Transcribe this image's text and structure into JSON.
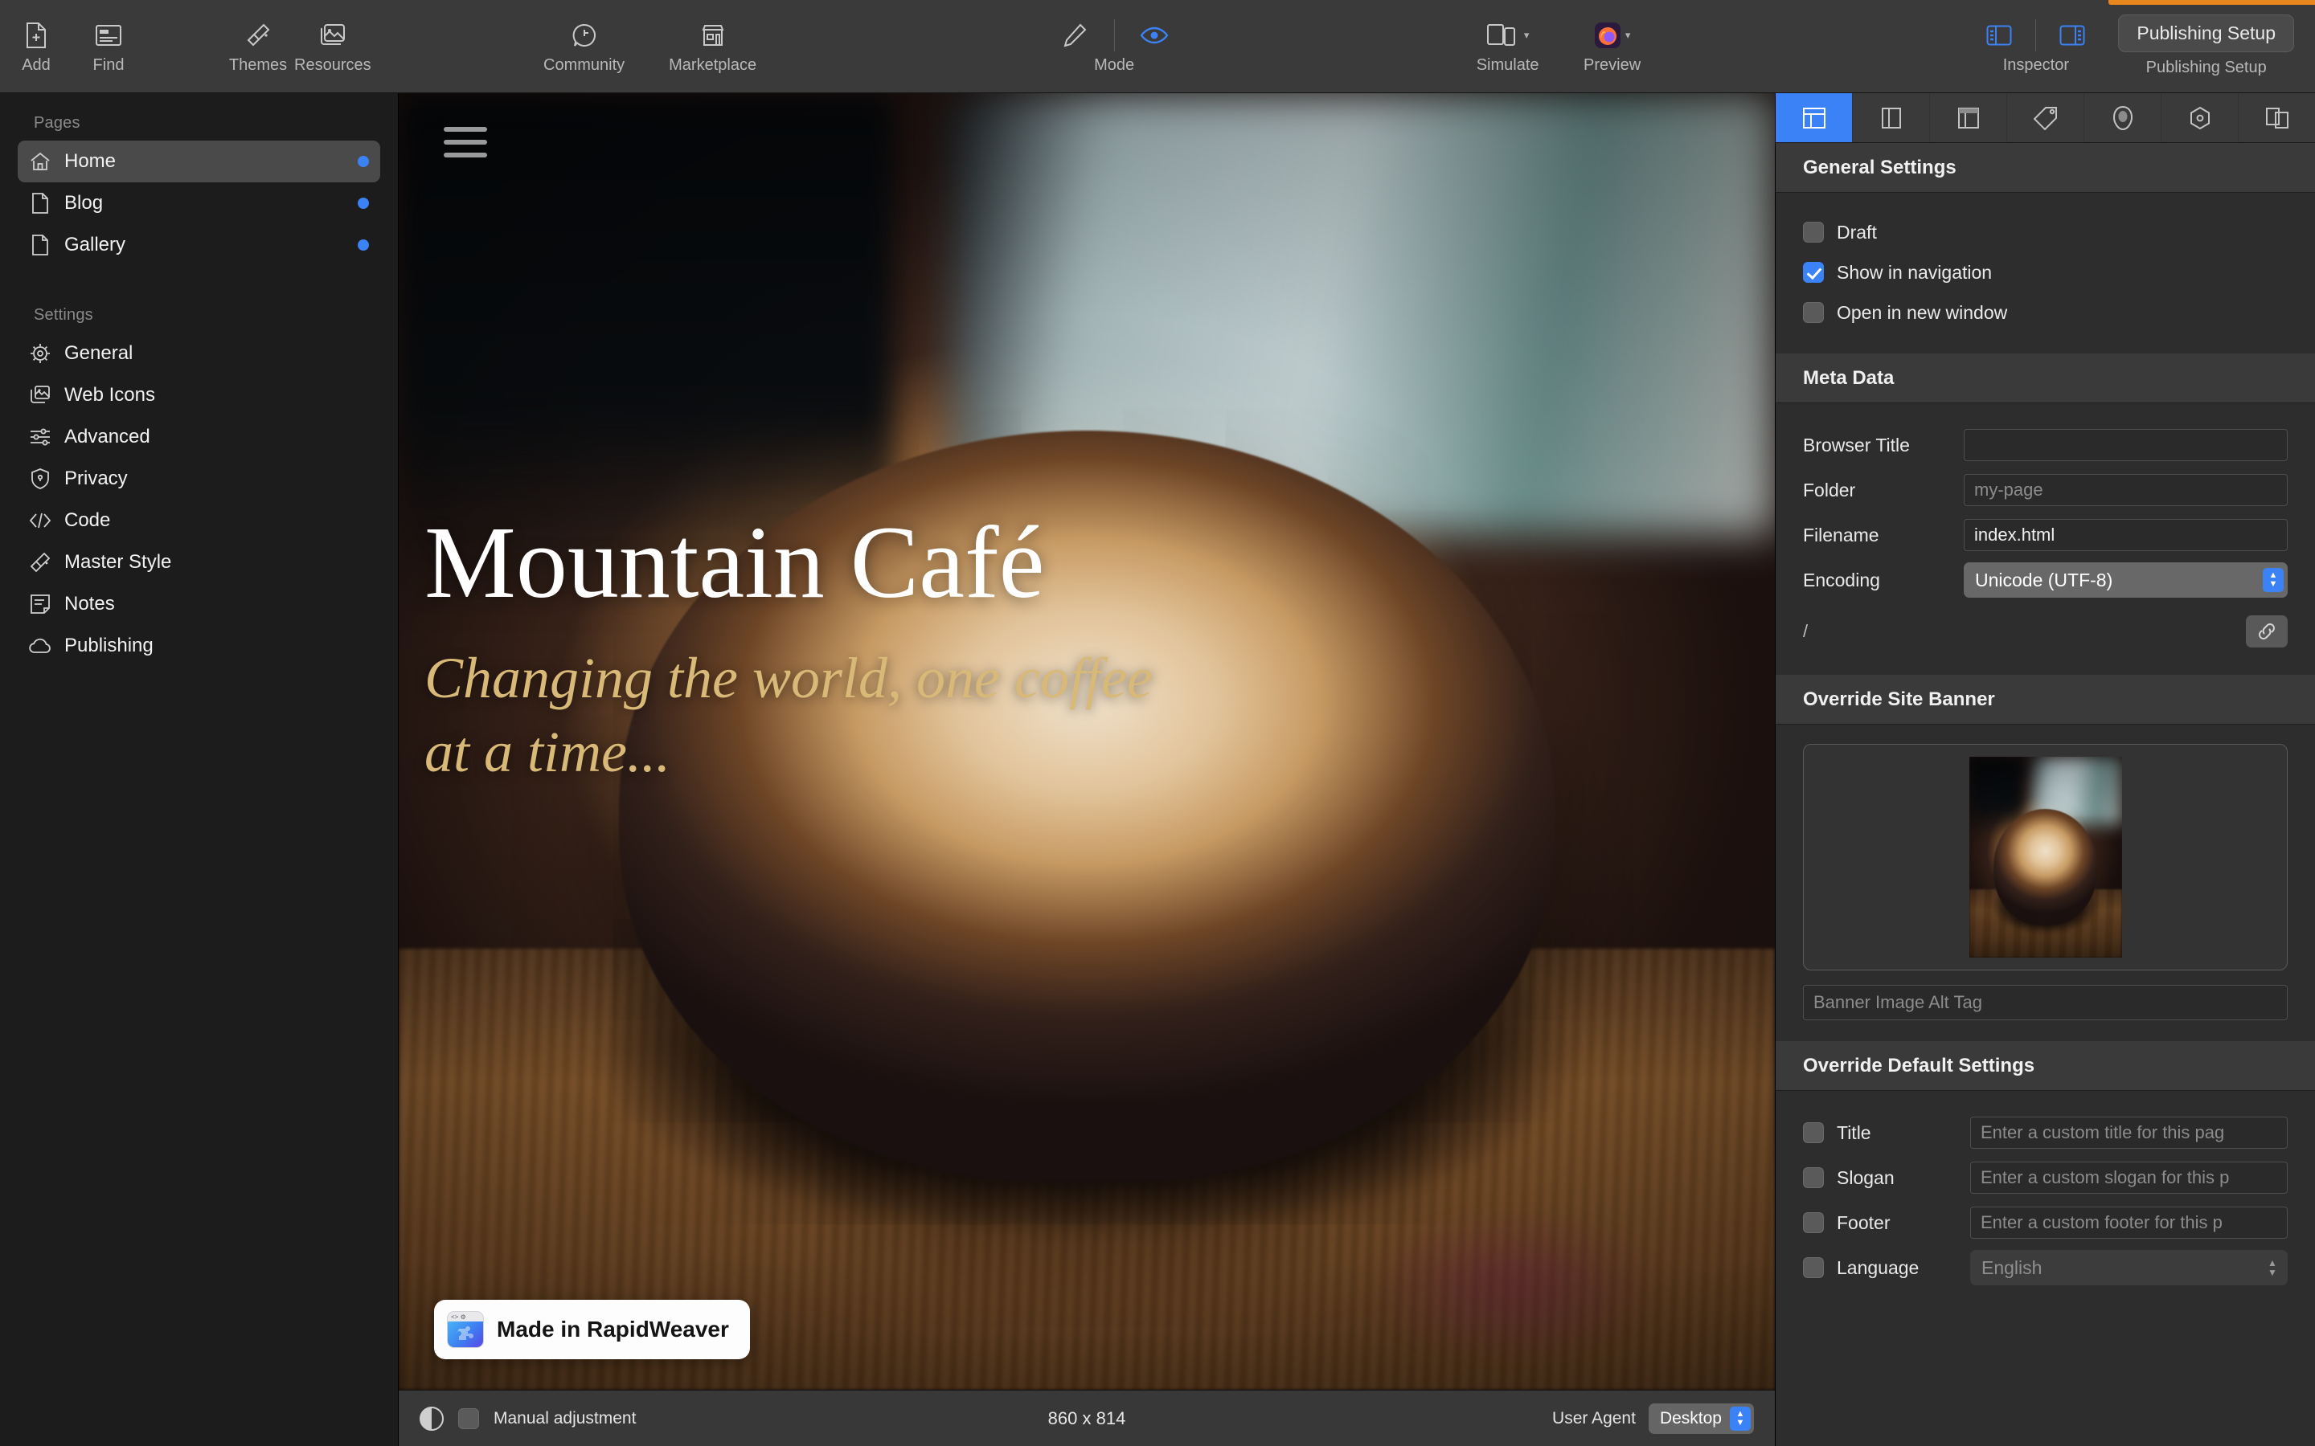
{
  "toolbar": {
    "items": [
      {
        "label": "Add",
        "icon": "add-page-icon"
      },
      {
        "label": "Find",
        "icon": "find-icon"
      },
      {
        "label": "Themes",
        "icon": "themes-brush-icon"
      },
      {
        "label": "Resources",
        "icon": "resources-images-icon"
      },
      {
        "label": "Community",
        "icon": "community-speech-icon"
      },
      {
        "label": "Marketplace",
        "icon": "marketplace-store-icon"
      }
    ],
    "mode": {
      "label": "Mode",
      "edit_icon": "pencil-icon",
      "preview_icon": "eye-icon",
      "active": "preview"
    },
    "simulate": {
      "label": "Simulate",
      "icon": "simulate-devices-icon"
    },
    "preview": {
      "label": "Preview",
      "icon": "firefox-icon"
    },
    "inspector": {
      "label": "Inspector",
      "left_icon": "sidebar-left-icon",
      "right_icon": "sidebar-right-icon"
    },
    "publishing": {
      "label": "Publishing Setup",
      "button_label": "Publishing Setup"
    },
    "accent_orange": "#e8861e"
  },
  "sidebar": {
    "pages_header": "Pages",
    "pages": [
      {
        "label": "Home",
        "icon": "home-icon",
        "active": true,
        "dot": true
      },
      {
        "label": "Blog",
        "icon": "page-icon",
        "active": false,
        "dot": true
      },
      {
        "label": "Gallery",
        "icon": "page-icon",
        "active": false,
        "dot": true
      }
    ],
    "settings_header": "Settings",
    "settings": [
      {
        "label": "General",
        "icon": "gear-icon"
      },
      {
        "label": "Web Icons",
        "icon": "web-icons-icon"
      },
      {
        "label": "Advanced",
        "icon": "sliders-icon"
      },
      {
        "label": "Privacy",
        "icon": "shield-lock-icon"
      },
      {
        "label": "Code",
        "icon": "code-icon"
      },
      {
        "label": "Master Style",
        "icon": "brush-icon"
      },
      {
        "label": "Notes",
        "icon": "notes-icon"
      },
      {
        "label": "Publishing",
        "icon": "cloud-icon"
      }
    ]
  },
  "canvas": {
    "menu_icon": "hamburger-menu-icon",
    "hero_title": "Mountain Café",
    "hero_tagline": "Changing the world, one coffee at a time...",
    "badge": {
      "text": "Made in RapidWeaver",
      "icon": "rapidweaver-icon"
    }
  },
  "statusbar": {
    "contrast_icon": "contrast-icon",
    "manual_adjustment_label": "Manual adjustment",
    "manual_adjustment_checked": false,
    "dimensions": "860 x 814",
    "user_agent_label": "User Agent",
    "user_agent_value": "Desktop"
  },
  "inspector": {
    "tabs": [
      {
        "name": "page-layout-tab",
        "icon": "layout-split-icon",
        "active": true
      },
      {
        "name": "sidebar-layout-tab",
        "icon": "layout-columns-icon",
        "active": false
      },
      {
        "name": "header-layout-tab",
        "icon": "layout-header-icon",
        "active": false
      },
      {
        "name": "tags-tab",
        "icon": "tag-icon",
        "active": false
      },
      {
        "name": "style-tab",
        "icon": "oval-icon",
        "active": false
      },
      {
        "name": "settings-tab",
        "icon": "hexagon-icon",
        "active": false
      },
      {
        "name": "stacks-tab",
        "icon": "stacks-icon",
        "active": false
      }
    ],
    "general_settings": {
      "title": "General Settings",
      "options": [
        {
          "label": "Draft",
          "checked": false
        },
        {
          "label": "Show in navigation",
          "checked": true
        },
        {
          "label": "Open in new window",
          "checked": false
        }
      ]
    },
    "meta_data": {
      "title": "Meta Data",
      "fields": [
        {
          "label": "Browser Title",
          "value": "",
          "placeholder": ""
        },
        {
          "label": "Folder",
          "value": "",
          "placeholder": "my-page"
        },
        {
          "label": "Filename",
          "value": "index.html",
          "placeholder": ""
        }
      ],
      "encoding_label": "Encoding",
      "encoding_value": "Unicode (UTF-8)",
      "path_value": "/",
      "link_icon": "link-icon"
    },
    "override_banner": {
      "title": "Override Site Banner",
      "alt_placeholder": "Banner Image Alt Tag"
    },
    "override_defaults": {
      "title": "Override Default Settings",
      "rows": [
        {
          "label": "Title",
          "checked": false,
          "placeholder": "Enter a custom title for this pag"
        },
        {
          "label": "Slogan",
          "checked": false,
          "placeholder": "Enter a custom slogan for this p"
        },
        {
          "label": "Footer",
          "checked": false,
          "placeholder": "Enter a custom footer for this p"
        }
      ],
      "language_label": "Language",
      "language_value": "English",
      "language_checked": false
    }
  }
}
